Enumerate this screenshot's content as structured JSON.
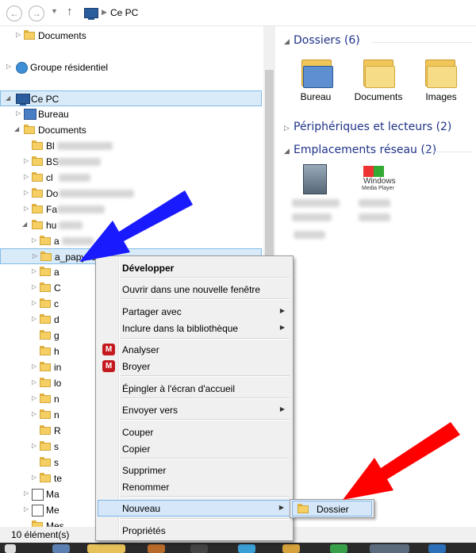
{
  "address": {
    "breadcrumb": "Ce PC"
  },
  "tree": {
    "documents_top": "Documents",
    "homegroup": "Groupe résidentiel",
    "this_pc": "Ce PC",
    "desktop": "Bureau",
    "documents": "Documents",
    "folder_prefixes": [
      "Bl",
      "BS",
      "cl",
      "Do",
      "Fa",
      "hu",
      "a",
      "a_papyflocon",
      "a",
      "C",
      "c",
      "d",
      "g",
      "h",
      "in",
      "lo",
      "n",
      "n",
      "R",
      "s",
      "s",
      "te",
      "Ma",
      "Me",
      "Mes"
    ],
    "selected_folder": "a_papyflocon"
  },
  "right_pane": {
    "folders_title": "Dossiers (6)",
    "folders": [
      "Bureau",
      "Documents",
      "Images"
    ],
    "devices_title": "Périphériques et lecteurs (2)",
    "network_title": "Emplacements réseau (2)",
    "wmp_label_1": "Windows",
    "wmp_label_2": "Media Player"
  },
  "context_menu": {
    "items": {
      "expand": "Développer",
      "open_new_window": "Ouvrir dans une nouvelle fenêtre",
      "share_with": "Partager avec",
      "include_library": "Inclure dans la bibliothèque",
      "analyze": "Analyser",
      "shred": "Broyer",
      "pin_start": "Épingler à l'écran d'accueil",
      "send_to": "Envoyer vers",
      "cut": "Couper",
      "copy": "Copier",
      "delete": "Supprimer",
      "rename": "Renommer",
      "new": "Nouveau",
      "properties": "Propriétés"
    }
  },
  "submenu": {
    "folder": "Dossier"
  },
  "status_bar": {
    "count": "10 élément(s)"
  },
  "colors": {
    "arrow_blue": "#1a1aff",
    "arrow_red": "#ff0000",
    "selection": "#d9ebf9"
  }
}
